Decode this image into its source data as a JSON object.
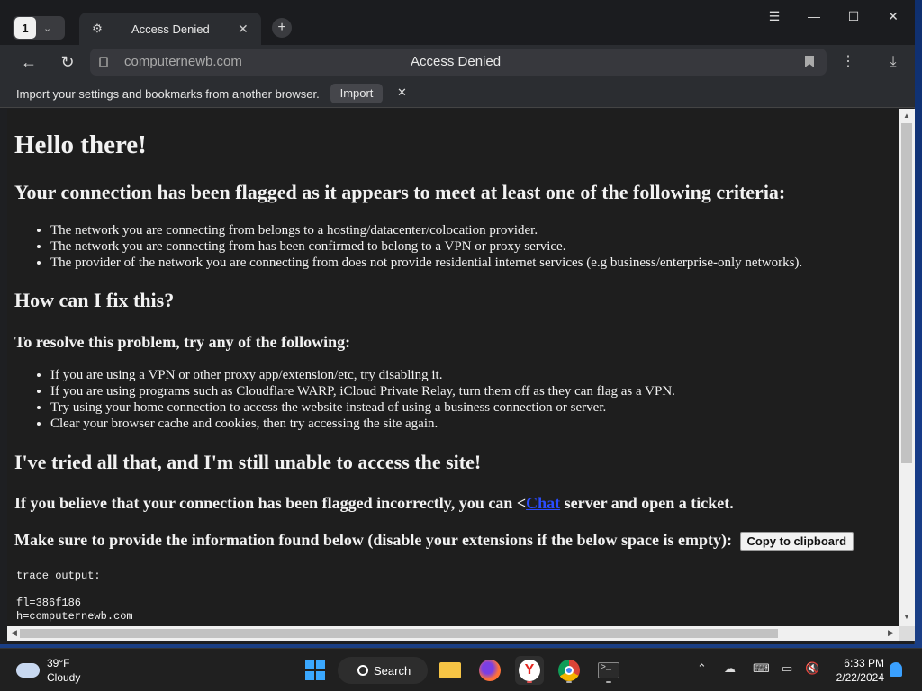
{
  "browser": {
    "tab_count": "1",
    "tab_title": "Access Denied",
    "url": "computernewb.com",
    "page_title": "Access Denied",
    "import_bar": {
      "message": "Import your settings and bookmarks from another browser.",
      "button": "Import"
    }
  },
  "page": {
    "h1": "Hello there!",
    "h2_flagged": "Your connection has been flagged as it appears to meet at least one of the following criteria:",
    "criteria": [
      "The network you are connecting from belongs to a hosting/datacenter/colocation provider.",
      "The network you are connecting from has been confirmed to belong to a VPN or proxy service.",
      "The provider of the network you are connecting from does not provide residential internet services (e.g business/enterprise-only networks)."
    ],
    "h2_fix": "How can I fix this?",
    "h3_resolve": "To resolve this problem, try any of the following:",
    "fixes": [
      "If you are using a VPN or other proxy app/extension/etc, try disabling it.",
      "If you are using programs such as Cloudflare WARP, iCloud Private Relay, turn them off as they can flag as a VPN.",
      "Try using your home connection to access the website instead of using a business connection or server.",
      "Clear your browser cache and cookies, then try accessing the site again."
    ],
    "h2_tried": "I've tried all that, and I'm still unable to access the site!",
    "contact_before": "If you believe that your connection has been flagged incorrectly, you can <",
    "contact_link": "Chat",
    "contact_after": " server and open a ticket.",
    "provide_info": "Make sure to provide the information found below (disable your extensions if the below space is empty):",
    "copy_button": "Copy to clipboard",
    "trace_label": "trace output:",
    "trace_lines": [
      "fl=386f186",
      "h=computernewb.com"
    ]
  },
  "taskbar": {
    "temperature": "39°F",
    "condition": "Cloudy",
    "search_label": "Search",
    "time": "6:33 PM",
    "date": "2/22/2024"
  }
}
